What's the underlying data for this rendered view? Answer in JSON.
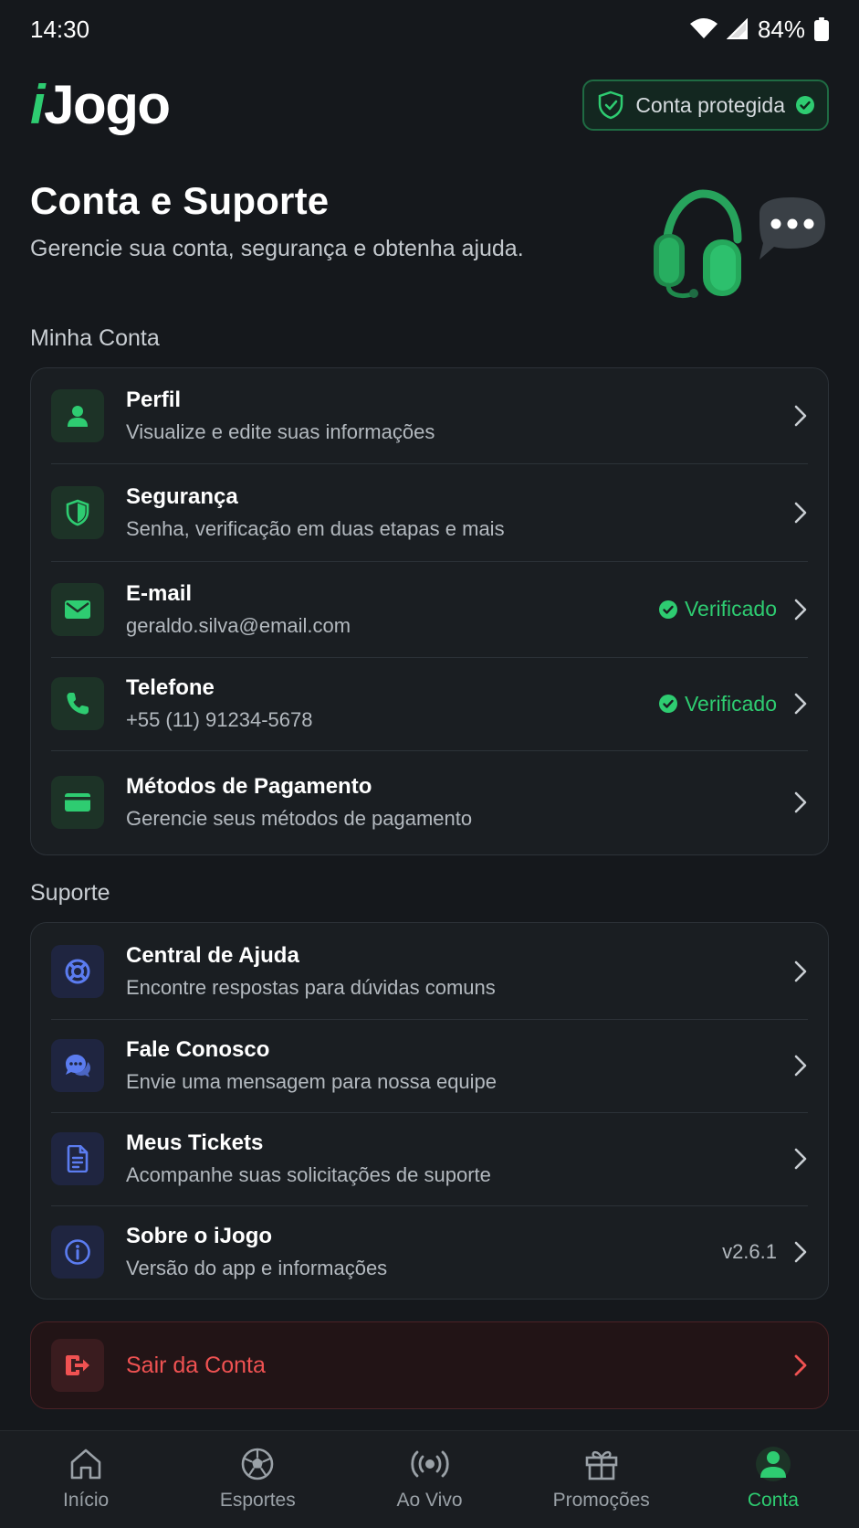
{
  "status_bar": {
    "time": "14:30",
    "battery": "84%"
  },
  "header": {
    "logo_i": "i",
    "logo_rest": "Jogo",
    "badge_label": "Conta protegida"
  },
  "hero": {
    "title": "Conta e Suporte",
    "subtitle": "Gerencie sua conta, segurança e obtenha ajuda."
  },
  "account": {
    "section_title": "Minha Conta",
    "items": [
      {
        "title": "Perfil",
        "subtitle": "Visualize e edite suas informações"
      },
      {
        "title": "Segurança",
        "subtitle": "Senha, verificação em duas etapas e mais"
      },
      {
        "title": "E-mail",
        "subtitle": "geraldo.silva@email.com",
        "status": "Verificado"
      },
      {
        "title": "Telefone",
        "subtitle": "+55 (11) 91234-5678",
        "status": "Verificado"
      },
      {
        "title": "Métodos de Pagamento",
        "subtitle": "Gerencie seus métodos de pagamento"
      }
    ]
  },
  "support": {
    "section_title": "Suporte",
    "items": [
      {
        "title": "Central de Ajuda",
        "subtitle": "Encontre respostas para dúvidas comuns"
      },
      {
        "title": "Fale Conosco",
        "subtitle": "Envie uma mensagem para nossa equipe"
      },
      {
        "title": "Meus Tickets",
        "subtitle": "Acompanhe suas solicitações de suporte"
      },
      {
        "title": "Sobre o iJogo",
        "subtitle": "Versão do app e informações",
        "version": "v2.6.1"
      }
    ]
  },
  "logout": {
    "label": "Sair da Conta"
  },
  "bottom_nav": {
    "items": [
      {
        "label": "Início",
        "icon": "home-icon"
      },
      {
        "label": "Esportes",
        "icon": "soccer-ball-icon"
      },
      {
        "label": "Ao Vivo",
        "icon": "live-broadcast-icon"
      },
      {
        "label": "Promoções",
        "icon": "gift-icon"
      },
      {
        "label": "Conta",
        "icon": "user-icon",
        "active": true
      }
    ]
  },
  "colors": {
    "background": "#15181c",
    "accent": "#2ecc71",
    "support_accent": "#5b7cf0",
    "danger": "#f05252"
  }
}
